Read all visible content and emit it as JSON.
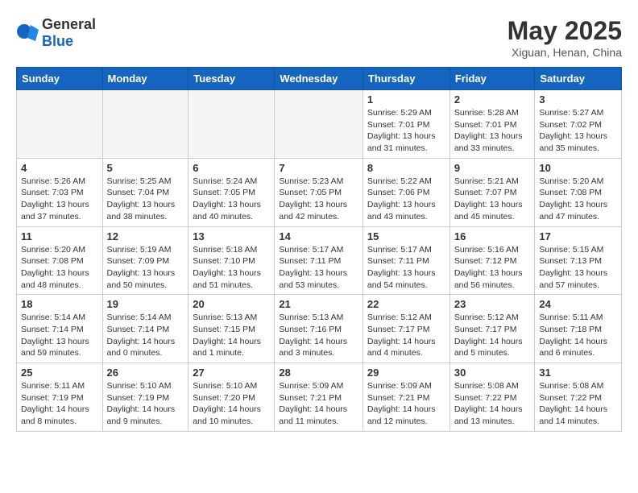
{
  "logo": {
    "general": "General",
    "blue": "Blue"
  },
  "title": {
    "month_year": "May 2025",
    "location": "Xiguan, Henan, China"
  },
  "weekdays": [
    "Sunday",
    "Monday",
    "Tuesday",
    "Wednesday",
    "Thursday",
    "Friday",
    "Saturday"
  ],
  "weeks": [
    [
      {
        "day": "",
        "empty": true
      },
      {
        "day": "",
        "empty": true
      },
      {
        "day": "",
        "empty": true
      },
      {
        "day": "",
        "empty": true
      },
      {
        "day": "1",
        "sunrise": "5:29 AM",
        "sunset": "7:01 PM",
        "daylight": "13 hours and 31 minutes."
      },
      {
        "day": "2",
        "sunrise": "5:28 AM",
        "sunset": "7:01 PM",
        "daylight": "13 hours and 33 minutes."
      },
      {
        "day": "3",
        "sunrise": "5:27 AM",
        "sunset": "7:02 PM",
        "daylight": "13 hours and 35 minutes."
      }
    ],
    [
      {
        "day": "4",
        "sunrise": "5:26 AM",
        "sunset": "7:03 PM",
        "daylight": "13 hours and 37 minutes."
      },
      {
        "day": "5",
        "sunrise": "5:25 AM",
        "sunset": "7:04 PM",
        "daylight": "13 hours and 38 minutes."
      },
      {
        "day": "6",
        "sunrise": "5:24 AM",
        "sunset": "7:05 PM",
        "daylight": "13 hours and 40 minutes."
      },
      {
        "day": "7",
        "sunrise": "5:23 AM",
        "sunset": "7:05 PM",
        "daylight": "13 hours and 42 minutes."
      },
      {
        "day": "8",
        "sunrise": "5:22 AM",
        "sunset": "7:06 PM",
        "daylight": "13 hours and 43 minutes."
      },
      {
        "day": "9",
        "sunrise": "5:21 AM",
        "sunset": "7:07 PM",
        "daylight": "13 hours and 45 minutes."
      },
      {
        "day": "10",
        "sunrise": "5:20 AM",
        "sunset": "7:08 PM",
        "daylight": "13 hours and 47 minutes."
      }
    ],
    [
      {
        "day": "11",
        "sunrise": "5:20 AM",
        "sunset": "7:08 PM",
        "daylight": "13 hours and 48 minutes."
      },
      {
        "day": "12",
        "sunrise": "5:19 AM",
        "sunset": "7:09 PM",
        "daylight": "13 hours and 50 minutes."
      },
      {
        "day": "13",
        "sunrise": "5:18 AM",
        "sunset": "7:10 PM",
        "daylight": "13 hours and 51 minutes."
      },
      {
        "day": "14",
        "sunrise": "5:17 AM",
        "sunset": "7:11 PM",
        "daylight": "13 hours and 53 minutes."
      },
      {
        "day": "15",
        "sunrise": "5:17 AM",
        "sunset": "7:11 PM",
        "daylight": "13 hours and 54 minutes."
      },
      {
        "day": "16",
        "sunrise": "5:16 AM",
        "sunset": "7:12 PM",
        "daylight": "13 hours and 56 minutes."
      },
      {
        "day": "17",
        "sunrise": "5:15 AM",
        "sunset": "7:13 PM",
        "daylight": "13 hours and 57 minutes."
      }
    ],
    [
      {
        "day": "18",
        "sunrise": "5:14 AM",
        "sunset": "7:14 PM",
        "daylight": "13 hours and 59 minutes."
      },
      {
        "day": "19",
        "sunrise": "5:14 AM",
        "sunset": "7:14 PM",
        "daylight": "14 hours and 0 minutes."
      },
      {
        "day": "20",
        "sunrise": "5:13 AM",
        "sunset": "7:15 PM",
        "daylight": "14 hours and 1 minute."
      },
      {
        "day": "21",
        "sunrise": "5:13 AM",
        "sunset": "7:16 PM",
        "daylight": "14 hours and 3 minutes."
      },
      {
        "day": "22",
        "sunrise": "5:12 AM",
        "sunset": "7:17 PM",
        "daylight": "14 hours and 4 minutes."
      },
      {
        "day": "23",
        "sunrise": "5:12 AM",
        "sunset": "7:17 PM",
        "daylight": "14 hours and 5 minutes."
      },
      {
        "day": "24",
        "sunrise": "5:11 AM",
        "sunset": "7:18 PM",
        "daylight": "14 hours and 6 minutes."
      }
    ],
    [
      {
        "day": "25",
        "sunrise": "5:11 AM",
        "sunset": "7:19 PM",
        "daylight": "14 hours and 8 minutes."
      },
      {
        "day": "26",
        "sunrise": "5:10 AM",
        "sunset": "7:19 PM",
        "daylight": "14 hours and 9 minutes."
      },
      {
        "day": "27",
        "sunrise": "5:10 AM",
        "sunset": "7:20 PM",
        "daylight": "14 hours and 10 minutes."
      },
      {
        "day": "28",
        "sunrise": "5:09 AM",
        "sunset": "7:21 PM",
        "daylight": "14 hours and 11 minutes."
      },
      {
        "day": "29",
        "sunrise": "5:09 AM",
        "sunset": "7:21 PM",
        "daylight": "14 hours and 12 minutes."
      },
      {
        "day": "30",
        "sunrise": "5:08 AM",
        "sunset": "7:22 PM",
        "daylight": "14 hours and 13 minutes."
      },
      {
        "day": "31",
        "sunrise": "5:08 AM",
        "sunset": "7:22 PM",
        "daylight": "14 hours and 14 minutes."
      }
    ]
  ]
}
